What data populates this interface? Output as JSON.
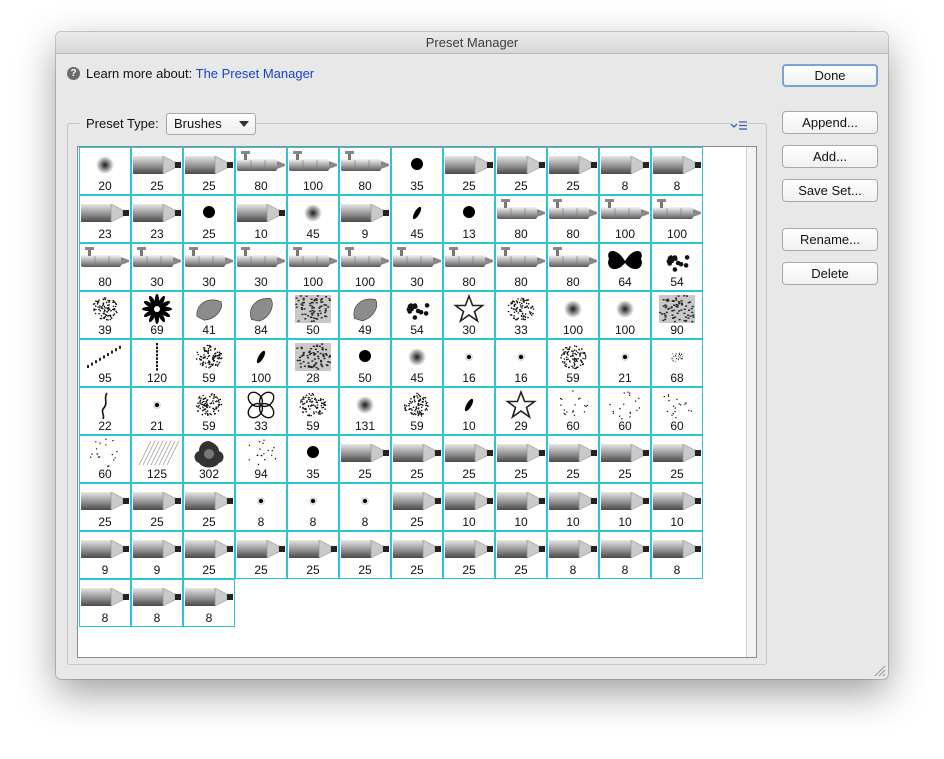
{
  "window": {
    "title": "Preset Manager"
  },
  "help": {
    "icon": "help-icon",
    "prefix": "Learn more about:",
    "link": "The Preset Manager"
  },
  "preset_type": {
    "label": "Preset Type:",
    "value": "Brushes"
  },
  "buttons": {
    "done": "Done",
    "append": "Append...",
    "add": "Add...",
    "save_set": "Save Set...",
    "rename": "Rename...",
    "delete": "Delete"
  },
  "brushes": [
    {
      "icon": "soft-round",
      "size": "20"
    },
    {
      "icon": "pencil",
      "size": "25"
    },
    {
      "icon": "pencil",
      "size": "25"
    },
    {
      "icon": "airbrush",
      "size": "80"
    },
    {
      "icon": "airbrush",
      "size": "100"
    },
    {
      "icon": "airbrush",
      "size": "80"
    },
    {
      "icon": "hard-round",
      "size": "35"
    },
    {
      "icon": "pencil",
      "size": "25"
    },
    {
      "icon": "pencil",
      "size": "25"
    },
    {
      "icon": "pencil",
      "size": "25"
    },
    {
      "icon": "pencil",
      "size": "8"
    },
    {
      "icon": "pencil",
      "size": "8"
    },
    {
      "icon": "pencil",
      "size": "23"
    },
    {
      "icon": "pencil",
      "size": "23"
    },
    {
      "icon": "hard-round",
      "size": "25"
    },
    {
      "icon": "pencil",
      "size": "10"
    },
    {
      "icon": "soft-round",
      "size": "45"
    },
    {
      "icon": "pencil",
      "size": "9"
    },
    {
      "icon": "flat-angle",
      "size": "45"
    },
    {
      "icon": "hard-round",
      "size": "13"
    },
    {
      "icon": "airbrush",
      "size": "80"
    },
    {
      "icon": "airbrush",
      "size": "80"
    },
    {
      "icon": "airbrush",
      "size": "100"
    },
    {
      "icon": "airbrush",
      "size": "100"
    },
    {
      "icon": "airbrush",
      "size": "80"
    },
    {
      "icon": "airbrush",
      "size": "30"
    },
    {
      "icon": "airbrush",
      "size": "30"
    },
    {
      "icon": "airbrush",
      "size": "30"
    },
    {
      "icon": "airbrush",
      "size": "100"
    },
    {
      "icon": "airbrush",
      "size": "100"
    },
    {
      "icon": "airbrush",
      "size": "30"
    },
    {
      "icon": "airbrush",
      "size": "80"
    },
    {
      "icon": "airbrush",
      "size": "80"
    },
    {
      "icon": "airbrush",
      "size": "80"
    },
    {
      "icon": "butterfly",
      "size": "64"
    },
    {
      "icon": "dots",
      "size": "54"
    },
    {
      "icon": "scatter",
      "size": "39"
    },
    {
      "icon": "flower",
      "size": "69"
    },
    {
      "icon": "leaf",
      "size": "41"
    },
    {
      "icon": "leaf",
      "size": "84"
    },
    {
      "icon": "texture",
      "size": "50"
    },
    {
      "icon": "leaf",
      "size": "49"
    },
    {
      "icon": "dots",
      "size": "54"
    },
    {
      "icon": "star",
      "size": "30"
    },
    {
      "icon": "scatter",
      "size": "33"
    },
    {
      "icon": "soft-round",
      "size": "100"
    },
    {
      "icon": "soft-round",
      "size": "100"
    },
    {
      "icon": "texture",
      "size": "90"
    },
    {
      "icon": "chain",
      "size": "95"
    },
    {
      "icon": "dash-line",
      "size": "120"
    },
    {
      "icon": "scatter",
      "size": "59"
    },
    {
      "icon": "flat-angle",
      "size": "100"
    },
    {
      "icon": "texture",
      "size": "28"
    },
    {
      "icon": "hard-round",
      "size": "50"
    },
    {
      "icon": "soft-round",
      "size": "45"
    },
    {
      "icon": "tiny-dot",
      "size": "16"
    },
    {
      "icon": "tiny-dot",
      "size": "16"
    },
    {
      "icon": "scatter",
      "size": "59"
    },
    {
      "icon": "tiny-dot",
      "size": "21"
    },
    {
      "icon": "spark",
      "size": "68"
    },
    {
      "icon": "stroke",
      "size": "22"
    },
    {
      "icon": "tiny-dot",
      "size": "21"
    },
    {
      "icon": "scatter",
      "size": "59"
    },
    {
      "icon": "clover",
      "size": "33"
    },
    {
      "icon": "scatter",
      "size": "59"
    },
    {
      "icon": "soft-round",
      "size": "131"
    },
    {
      "icon": "scatter",
      "size": "59"
    },
    {
      "icon": "flat-angle",
      "size": "10"
    },
    {
      "icon": "star",
      "size": "29"
    },
    {
      "icon": "sparse-dots",
      "size": "60"
    },
    {
      "icon": "sparse-dots",
      "size": "60"
    },
    {
      "icon": "sparse-dots",
      "size": "60"
    },
    {
      "icon": "sparse-dots",
      "size": "60"
    },
    {
      "icon": "hatch",
      "size": "125"
    },
    {
      "icon": "flower-big",
      "size": "302"
    },
    {
      "icon": "sparse-dots",
      "size": "94"
    },
    {
      "icon": "hard-round",
      "size": "35"
    },
    {
      "icon": "pencil",
      "size": "25"
    },
    {
      "icon": "pencil",
      "size": "25"
    },
    {
      "icon": "pencil",
      "size": "25"
    },
    {
      "icon": "pencil",
      "size": "25"
    },
    {
      "icon": "pencil",
      "size": "25"
    },
    {
      "icon": "pencil",
      "size": "25"
    },
    {
      "icon": "pencil",
      "size": "25"
    },
    {
      "icon": "pencil",
      "size": "25"
    },
    {
      "icon": "pencil",
      "size": "25"
    },
    {
      "icon": "pencil",
      "size": "25"
    },
    {
      "icon": "tiny-dot",
      "size": "8"
    },
    {
      "icon": "tiny-dot",
      "size": "8"
    },
    {
      "icon": "tiny-dot",
      "size": "8"
    },
    {
      "icon": "pencil",
      "size": "25"
    },
    {
      "icon": "pencil",
      "size": "10"
    },
    {
      "icon": "pencil",
      "size": "10"
    },
    {
      "icon": "pencil",
      "size": "10"
    },
    {
      "icon": "pencil",
      "size": "10"
    },
    {
      "icon": "pencil",
      "size": "10"
    },
    {
      "icon": "pencil",
      "size": "9"
    },
    {
      "icon": "pencil",
      "size": "9"
    },
    {
      "icon": "pencil",
      "size": "25"
    },
    {
      "icon": "pencil",
      "size": "25"
    },
    {
      "icon": "pencil",
      "size": "25"
    },
    {
      "icon": "pencil",
      "size": "25"
    },
    {
      "icon": "pencil",
      "size": "25"
    },
    {
      "icon": "pencil",
      "size": "25"
    },
    {
      "icon": "pencil",
      "size": "25"
    },
    {
      "icon": "pencil",
      "size": "8"
    },
    {
      "icon": "pencil",
      "size": "8"
    },
    {
      "icon": "pencil",
      "size": "8"
    },
    {
      "icon": "pencil",
      "size": "8"
    },
    {
      "icon": "pencil",
      "size": "8"
    },
    {
      "icon": "pencil",
      "size": "8"
    }
  ],
  "colors": {
    "selection_border": "#2fc3d6",
    "link": "#1a3fd6",
    "default_button_border": "#7ca1d9"
  }
}
